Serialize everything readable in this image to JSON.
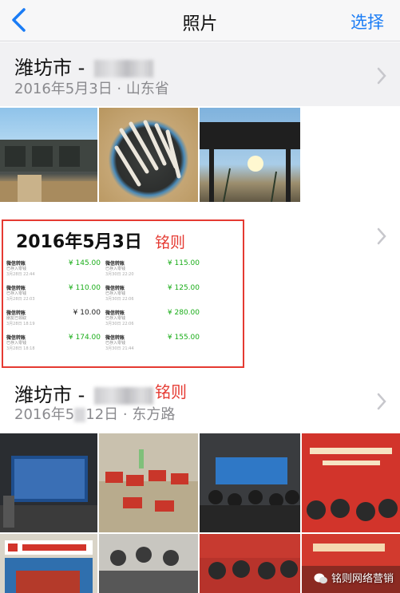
{
  "nav": {
    "back_icon": "chevron-left-icon",
    "title": "照片",
    "select_label": "选择",
    "accent_color": "#1a7cf5"
  },
  "moments": [
    {
      "title_prefix": "潍坊市 - ",
      "subtitle": "2016年5月3日 · 山东省"
    },
    {
      "title": "2016年5月3日",
      "tag": "铭则"
    },
    {
      "title_prefix": "潍坊市 - ",
      "tag": "铭则",
      "subtitle_left": "2016年5",
      "subtitle_right": "12日 · 东方路"
    }
  ],
  "receipt": {
    "transactions": [
      {
        "name": "微信转账",
        "status": "已存入零钱",
        "time": "3月28日 22:44",
        "amount": "¥ 145.00"
      },
      {
        "name": "微信转账",
        "status": "已存入零钱",
        "time": "3月30日 22:20",
        "amount": "¥ 115.00"
      },
      {
        "name": "微信转账",
        "status": "已存入零钱",
        "time": "3月28日 22:03",
        "amount": "¥ 110.00"
      },
      {
        "name": "微信转账",
        "status": "已存入零钱",
        "time": "3月30日 22:06",
        "amount": "¥ 125.00"
      },
      {
        "name": "微信转账",
        "status": "朋友已领取",
        "time": "3月28日 18:19",
        "amount": "¥ 10.00"
      },
      {
        "name": "微信转账",
        "status": "已存入零钱",
        "time": "3月30日 22:06",
        "amount": "¥ 280.00"
      },
      {
        "name": "微信转账",
        "status": "已存入零钱",
        "time": "3月28日 18:18",
        "amount": "¥ 174.00"
      },
      {
        "name": "微信转账",
        "status": "已存入零钱",
        "time": "3月30日 21:44",
        "amount": "¥ 155.00"
      }
    ]
  },
  "watermark": {
    "text": "铭则网络营销"
  }
}
